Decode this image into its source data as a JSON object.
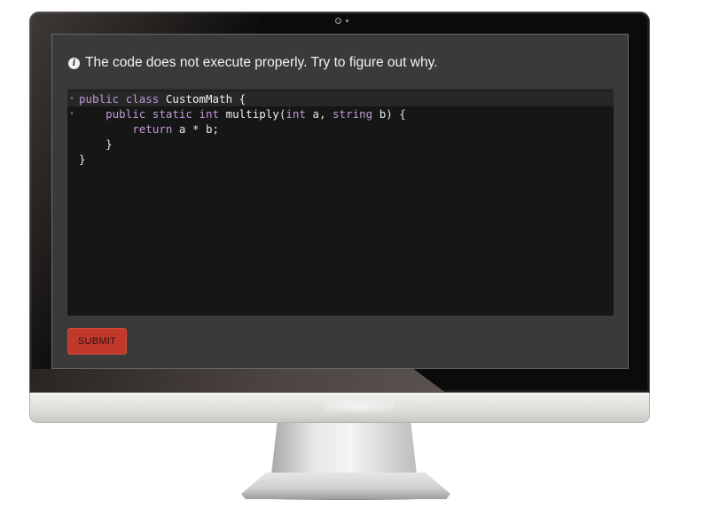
{
  "prompt": {
    "text": "The code does not execute properly. Try to figure out why.",
    "icon": "info-icon"
  },
  "editor": {
    "lines": [
      {
        "indent": "",
        "tokens": [
          [
            "kw",
            "public"
          ],
          [
            "pl",
            " "
          ],
          [
            "kw",
            "class"
          ],
          [
            "pl",
            " "
          ],
          [
            "cls",
            "CustomMath"
          ],
          [
            "pl",
            " {"
          ]
        ],
        "fold": true,
        "active": true
      },
      {
        "indent": "    ",
        "tokens": [
          [
            "kw",
            "public"
          ],
          [
            "pl",
            " "
          ],
          [
            "kw",
            "static"
          ],
          [
            "pl",
            " "
          ],
          [
            "ty",
            "int"
          ],
          [
            "pl",
            " "
          ],
          [
            "fn",
            "multiply"
          ],
          [
            "pl",
            "("
          ],
          [
            "ty",
            "int"
          ],
          [
            "pl",
            " a, "
          ],
          [
            "ty",
            "string"
          ],
          [
            "pl",
            " b) {"
          ]
        ],
        "fold": true,
        "active": false
      },
      {
        "indent": "        ",
        "tokens": [
          [
            "kw",
            "return"
          ],
          [
            "pl",
            " a * b;"
          ]
        ],
        "fold": false,
        "active": false
      },
      {
        "indent": "    ",
        "tokens": [
          [
            "pl",
            "}"
          ]
        ],
        "fold": false,
        "active": false
      },
      {
        "indent": "",
        "tokens": [
          [
            "pl",
            "}"
          ]
        ],
        "fold": false,
        "active": false
      }
    ],
    "colors": {
      "background": "#151717",
      "keyword": "#c397d8",
      "text": "#e6e6e6"
    }
  },
  "submit": {
    "label": "SUBMIT",
    "color": "#c0392b"
  }
}
